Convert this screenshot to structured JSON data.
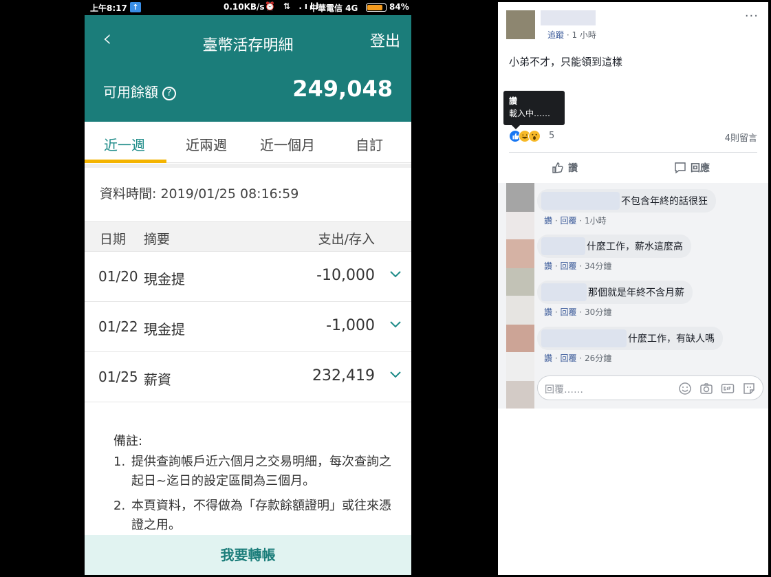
{
  "phone": {
    "statusbar": {
      "time": "上午8:17",
      "upload_glyph": "↑",
      "speed": "0.10KB/s",
      "icons": "⏰ ⇅ .ıll",
      "carrier": "中華電信 4G",
      "battery": "84%",
      "battery_level": 0.84
    },
    "header": {
      "back_glyph": "‹",
      "title": "臺幣活存明細",
      "logout": "登出",
      "balance_label": "可用餘額",
      "help_glyph": "?",
      "balance_value": "249,048"
    },
    "tabs": [
      "近一週",
      "近兩週",
      "近一個月",
      "自訂"
    ],
    "active_tab_index": 0,
    "data_time": "資料時間: 2019/01/25 08:16:59",
    "table": {
      "headers": {
        "date": "日期",
        "desc": "摘要",
        "amount": "支出/存入"
      },
      "rows": [
        {
          "date": "01/20",
          "desc": "現金提",
          "amount": "-10,000"
        },
        {
          "date": "01/22",
          "desc": "現金提",
          "amount": "-1,000"
        },
        {
          "date": "01/25",
          "desc": "薪資",
          "amount": "232,419"
        }
      ]
    },
    "notes": {
      "title": "備註:",
      "items": [
        {
          "num": "1.",
          "text": "提供查詢帳戶近六個月之交易明細，每次查詢之起日~迄日的設定區間為三個月。"
        },
        {
          "num": "2.",
          "text": "本頁資料，不得做為「存款餘額證明」或往來憑證之用。"
        }
      ]
    },
    "transfer_button": "我要轉帳",
    "colors": {
      "header": "#1b7d7a",
      "accent": "#1b8a87",
      "tab_underline": "#f4b400",
      "transfer_bg": "#e1f3f1"
    }
  },
  "fb": {
    "post": {
      "follow": "追蹤",
      "time": "· 1 小時",
      "more_glyph": "···",
      "text": "小弟不才，只能領到這樣"
    },
    "tooltip": {
      "title": "讚",
      "body": "載入中……"
    },
    "reactions": {
      "count": "5",
      "icons": [
        "like-icon",
        "haha-icon",
        "wow-icon"
      ]
    },
    "comments_count": "4則留言",
    "actions": {
      "like": "讚",
      "comment": "回應"
    },
    "comments": [
      {
        "text": "不包含年終的話很狂",
        "like": "讚",
        "reply": "回覆",
        "time": "1小時"
      },
      {
        "text": "什麼工作，薪水這麼高",
        "like": "讚",
        "reply": "回覆",
        "time": "34分鐘"
      },
      {
        "text": "那個就是年終不含月薪",
        "like": "讚",
        "reply": "回覆",
        "time": "30分鐘"
      },
      {
        "text": "什麼工作，有缺人嗎",
        "like": "讚",
        "reply": "回覆",
        "time": "26分鐘"
      }
    ],
    "reply_placeholder": "回覆……",
    "colors": {
      "link": "#385898",
      "bubble": "#e9ebee",
      "like_blue": "#1877f2"
    }
  }
}
